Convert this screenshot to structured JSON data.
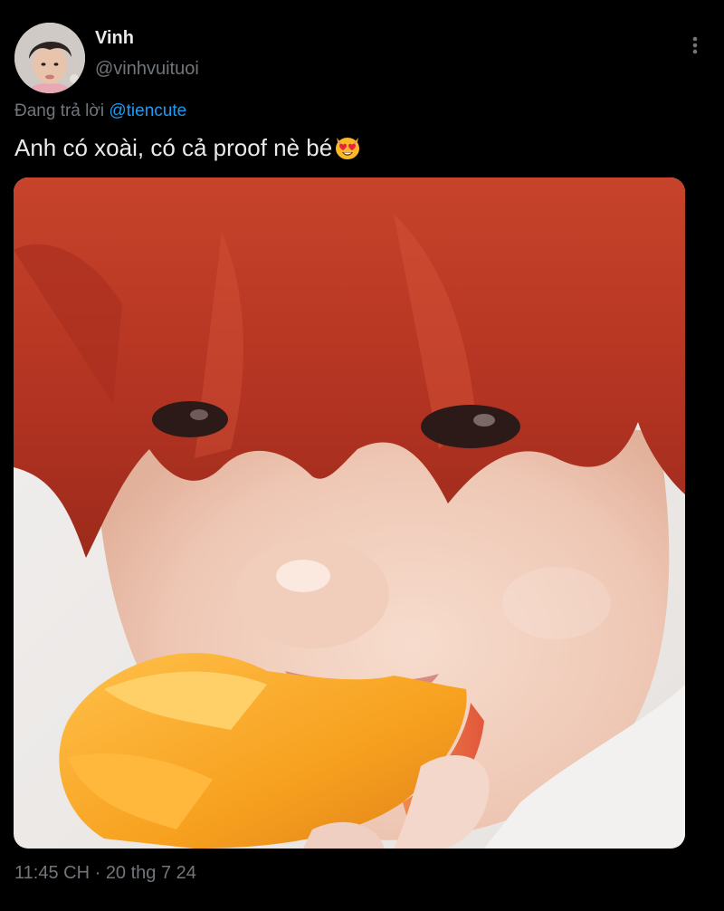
{
  "user": {
    "display_name": "Vinh",
    "handle": "@vinhvuituoi"
  },
  "reply": {
    "prefix": "Đang trả lời",
    "mention": "@tiencute"
  },
  "tweet": {
    "text": "Anh có xoài, có cả proof nè bé",
    "emoji_icon": "heart-eyes-cat-emoji"
  },
  "meta": {
    "time": "11:45 CH",
    "separator": "·",
    "date": "20 thg 7 24"
  },
  "colors": {
    "background": "#000000",
    "primary_text": "#e7e9ea",
    "secondary_text": "#71767b",
    "accent": "#1d9bf0"
  },
  "icons": {
    "more": "more-vertical-icon"
  }
}
